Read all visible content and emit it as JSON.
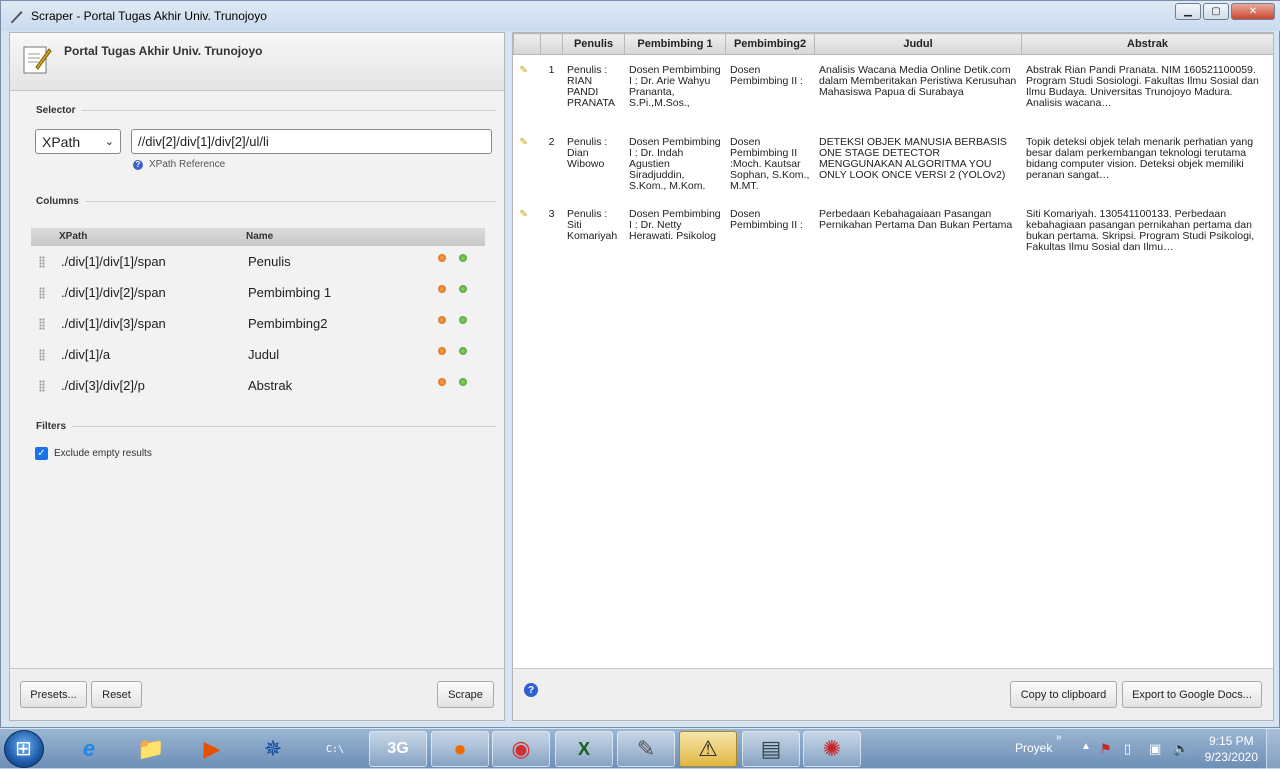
{
  "window": {
    "title": "Scraper - Portal Tugas Akhir Univ. Trunojoyo",
    "controls": {
      "minimize": "▁",
      "maximize": "▢",
      "close": "✕"
    }
  },
  "left": {
    "site_title": "Portal Tugas Akhir Univ. Trunojoyo",
    "selector_label": "Selector",
    "selector_type": "XPath",
    "selector_value": "//div[2]/div[1]/div[2]/ul/li",
    "xpath_reference": "XPath Reference",
    "columns_label": "Columns",
    "columns_header": {
      "xpath": "XPath",
      "name": "Name"
    },
    "columns": [
      {
        "xpath": "./div[1]/div[1]/span",
        "name": "Penulis"
      },
      {
        "xpath": "./div[1]/div[2]/span",
        "name": "Pembimbing 1"
      },
      {
        "xpath": "./div[1]/div[3]/span",
        "name": "Pembimbing2"
      },
      {
        "xpath": "./div[1]/a",
        "name": "Judul"
      },
      {
        "xpath": "./div[3]/div[2]/p",
        "name": "Abstrak"
      }
    ],
    "filters_label": "Filters",
    "exclude_empty": "Exclude empty results",
    "buttons": {
      "presets": "Presets...",
      "reset": "Reset",
      "scrape": "Scrape"
    }
  },
  "results": {
    "headers": [
      "Penulis",
      "Pembimbing 1",
      "Pembimbing2",
      "Judul",
      "Abstrak"
    ],
    "rows": [
      {
        "index": "1",
        "penulis": "Penulis : RIAN PANDI PRANATA",
        "pembimbing1": "Dosen Pembimbing I : Dr. Arie Wahyu Prananta, S.Pi.,M.Sos.,",
        "pembimbing2": "Dosen Pembimbing II :",
        "judul": "Analisis Wacana Media Online Detik.com dalam Memberitakan Peristiwa Kerusuhan Mahasiswa Papua di Surabaya",
        "abstrak": "Abstrak Rian Pandi Pranata. NIM 160521100059. Program Studi Sosiologi. Fakultas Ilmu Sosial dan Ilmu Budaya. Universitas Trunojoyo Madura. Analisis wacana…"
      },
      {
        "index": "2",
        "penulis": "Penulis : Dian Wibowo",
        "pembimbing1": "Dosen Pembimbing I : Dr. Indah Agustien Siradjuddin, S.Kom., M.Kom.",
        "pembimbing2": "Dosen Pembimbing II :Moch. Kautsar Sophan, S.Kom., M.MT.",
        "judul": "DETEKSI OBJEK MANUSIA BERBASIS ONE STAGE DETECTOR MENGGUNAKAN ALGORITMA YOU ONLY LOOK ONCE VERSI 2 (YOLOv2)",
        "abstrak": "Topik deteksi objek telah menarik perhatian yang besar dalam perkembangan teknologi terutama bidang computer vision. Deteksi objek memiliki peranan sangat…"
      },
      {
        "index": "3",
        "penulis": "Penulis : Siti Komariyah",
        "pembimbing1": "Dosen Pembimbing I : Dr. Netty Herawati. Psikolog",
        "pembimbing2": "Dosen Pembimbing II :",
        "judul": "Perbedaan Kebahagaiaan Pasangan Pernikahan Pertama Dan Bukan Pertama",
        "abstrak": "Siti Komariyah. 130541100133. Perbedaan kebahagiaan pasangan pernikahan pertama dan bukan pertama. Skripsi. Program Studi Psikologi, Fakultas Ilmu Sosial dan Ilmu…"
      }
    ],
    "buttons": {
      "copy": "Copy to clipboard",
      "export": "Export to Google Docs..."
    }
  },
  "taskbar": {
    "items": [
      {
        "name": "internet-explorer-icon",
        "glyph": "e"
      },
      {
        "name": "file-explorer-icon",
        "glyph": "📁"
      },
      {
        "name": "media-player-icon",
        "glyph": "▶"
      },
      {
        "name": "compass-icon",
        "glyph": "✵"
      },
      {
        "name": "command-prompt-icon",
        "glyph": "C:\\"
      },
      {
        "name": "3g-modem-icon",
        "glyph": "3G"
      },
      {
        "name": "firefox-icon",
        "glyph": "●"
      },
      {
        "name": "chrome-icon",
        "glyph": "◉"
      },
      {
        "name": "excel-icon",
        "glyph": "X"
      },
      {
        "name": "scraper-notepad-icon",
        "glyph": "✎"
      },
      {
        "name": "warning-icon",
        "glyph": "⚠"
      },
      {
        "name": "notebook-icon",
        "glyph": "▤"
      },
      {
        "name": "colorful-app-icon",
        "glyph": "✺"
      }
    ],
    "tray_label": "Proyek",
    "time": "9:15 PM",
    "date": "9/23/2020"
  }
}
